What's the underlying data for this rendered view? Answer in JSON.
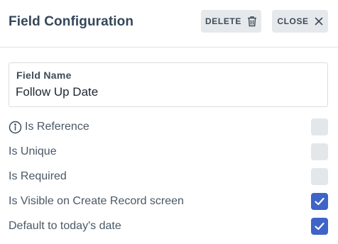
{
  "header": {
    "title": "Field Configuration",
    "delete_label": "DELETE",
    "close_label": "CLOSE"
  },
  "field": {
    "label": "Field Name",
    "value": "Follow Up Date"
  },
  "options": [
    {
      "label": "Is Reference",
      "checked": false,
      "has_info_icon": true
    },
    {
      "label": "Is Unique",
      "checked": false
    },
    {
      "label": "Is Required",
      "checked": false
    },
    {
      "label": "Is Visible on Create Record screen",
      "checked": true
    },
    {
      "label": "Default to today's date",
      "checked": true
    }
  ],
  "colors": {
    "accent": "#3f64c8",
    "unchecked": "#e4e7ea",
    "button_bg": "#e6e9ec",
    "divider": "#dfe3e8"
  },
  "icons": {
    "delete": "trash-icon",
    "close": "close-icon",
    "info": "info-icon",
    "check": "checkmark-icon"
  }
}
